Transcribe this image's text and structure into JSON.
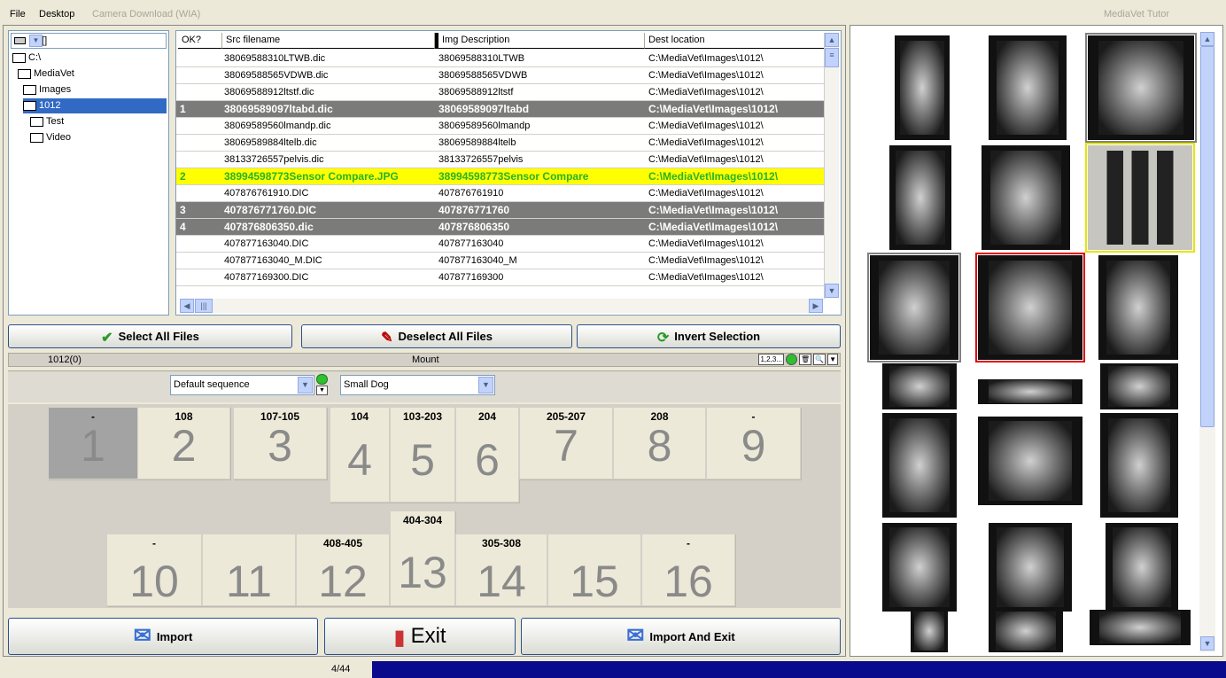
{
  "menu": {
    "file": "File",
    "desktop": "Desktop",
    "camera": "Camera Download (WIA)"
  },
  "app_title": "MediaVet Tutor",
  "tree": {
    "drive": "C: []",
    "items": [
      {
        "label": "C:\\",
        "level": 0
      },
      {
        "label": "MediaVet",
        "level": 1
      },
      {
        "label": "Images",
        "level": 2
      },
      {
        "label": "1012",
        "level": 3,
        "selected": true
      },
      {
        "label": "Test",
        "level": 4
      },
      {
        "label": "Video",
        "level": 4
      }
    ]
  },
  "grid": {
    "headers": [
      "OK?",
      "Src filename",
      "Img Description",
      "Dest location"
    ],
    "rows": [
      {
        "ok": "",
        "src": "38069588310LTWB.dic",
        "desc": "38069588310LTWB",
        "dest": "C:\\MediaVet\\Images\\1012\\",
        "style": ""
      },
      {
        "ok": "",
        "src": "38069588565VDWB.dic",
        "desc": "38069588565VDWB",
        "dest": "C:\\MediaVet\\Images\\1012\\",
        "style": ""
      },
      {
        "ok": "",
        "src": "38069588912ltstf.dic",
        "desc": "38069588912ltstf",
        "dest": "C:\\MediaVet\\Images\\1012\\",
        "style": ""
      },
      {
        "ok": "1",
        "src": "38069589097ltabd.dic",
        "desc": "38069589097ltabd",
        "dest": "C:\\MediaVet\\Images\\1012\\",
        "style": "gray"
      },
      {
        "ok": "",
        "src": "38069589560lmandp.dic",
        "desc": "38069589560lmandp",
        "dest": "C:\\MediaVet\\Images\\1012\\",
        "style": ""
      },
      {
        "ok": "",
        "src": "38069589884ltelb.dic",
        "desc": "38069589884ltelb",
        "dest": "C:\\MediaVet\\Images\\1012\\",
        "style": ""
      },
      {
        "ok": "",
        "src": "38133726557pelvis.dic",
        "desc": "38133726557pelvis",
        "dest": "C:\\MediaVet\\Images\\1012\\",
        "style": ""
      },
      {
        "ok": "2",
        "src": "38994598773Sensor Compare.JPG",
        "desc": "38994598773Sensor Compare",
        "dest": "C:\\MediaVet\\Images\\1012\\",
        "style": "yel"
      },
      {
        "ok": "",
        "src": "407876761910.DIC",
        "desc": "407876761910",
        "dest": "C:\\MediaVet\\Images\\1012\\",
        "style": ""
      },
      {
        "ok": "3",
        "src": "407876771760.DIC",
        "desc": "407876771760",
        "dest": "C:\\MediaVet\\Images\\1012\\",
        "style": "gray"
      },
      {
        "ok": "4",
        "src": "407876806350.dic",
        "desc": "407876806350",
        "dest": "C:\\MediaVet\\Images\\1012\\",
        "style": "gray"
      },
      {
        "ok": "",
        "src": "407877163040.DIC",
        "desc": "407877163040",
        "dest": "C:\\MediaVet\\Images\\1012\\",
        "style": ""
      },
      {
        "ok": "",
        "src": "407877163040_M.DIC",
        "desc": "407877163040_M",
        "dest": "C:\\MediaVet\\Images\\1012\\",
        "style": ""
      },
      {
        "ok": "",
        "src": "407877169300.DIC",
        "desc": "407877169300",
        "dest": "C:\\MediaVet\\Images\\1012\\",
        "style": ""
      }
    ]
  },
  "buttons": {
    "select_all": "Select All Files",
    "deselect_all": "Deselect All Files",
    "invert": "Invert Selection",
    "import": "Import",
    "exit": "Exit",
    "import_exit": "Import And Exit"
  },
  "status": {
    "folder": "1012(0)",
    "mount": "Mount",
    "numbering": "1,2,3..."
  },
  "sequence": {
    "selected": "Default sequence",
    "template": "Small Dog"
  },
  "slots": [
    {
      "num": "1",
      "label": "-"
    },
    {
      "num": "2",
      "label": "108"
    },
    {
      "num": "3",
      "label": "107-105"
    },
    {
      "num": "4",
      "label": "104"
    },
    {
      "num": "5",
      "label": "103-203"
    },
    {
      "num": "6",
      "label": "204"
    },
    {
      "num": "7",
      "label": "205-207"
    },
    {
      "num": "8",
      "label": "208"
    },
    {
      "num": "9",
      "label": "-"
    },
    {
      "num": "10",
      "label": "-"
    },
    {
      "num": "11",
      "label": ""
    },
    {
      "num": "12",
      "label": "408-405"
    },
    {
      "num": "13",
      "label": "404-304"
    },
    {
      "num": "14",
      "label": "305-308"
    },
    {
      "num": "15",
      "label": ""
    },
    {
      "num": "16",
      "label": "-"
    }
  ],
  "footer": {
    "count": "4/44"
  },
  "colors": {
    "selected_row": "#7b7b7b",
    "highlight_row": "#ffff00",
    "highlight_text": "#26b326",
    "selection_blue": "#316ac5",
    "progress": "#0a0a8c"
  }
}
